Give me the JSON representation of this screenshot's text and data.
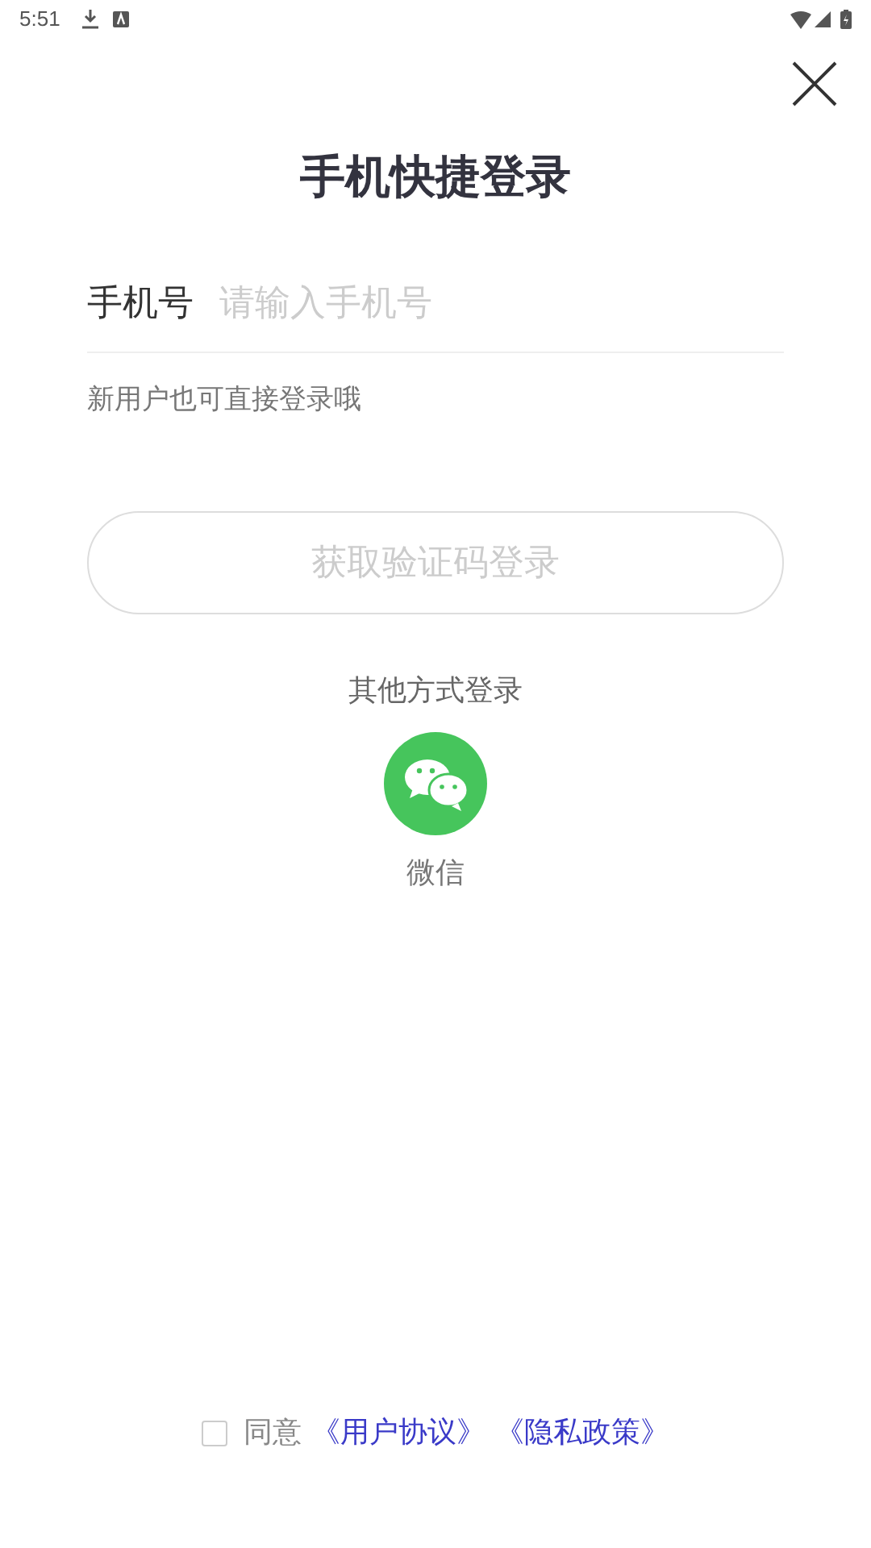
{
  "status_bar": {
    "time": "5:51"
  },
  "title": "手机快捷登录",
  "phone_field": {
    "label": "手机号",
    "placeholder": "请输入手机号"
  },
  "hint": "新用户也可直接登录哦",
  "submit_button": {
    "label": "获取验证码登录",
    "disabled": true
  },
  "other_login": {
    "heading": "其他方式登录",
    "options": [
      {
        "label": "微信"
      }
    ]
  },
  "agreement": {
    "checked": false,
    "text": "同意",
    "links": [
      "《用户协议》",
      "《隐私政策》"
    ]
  }
}
